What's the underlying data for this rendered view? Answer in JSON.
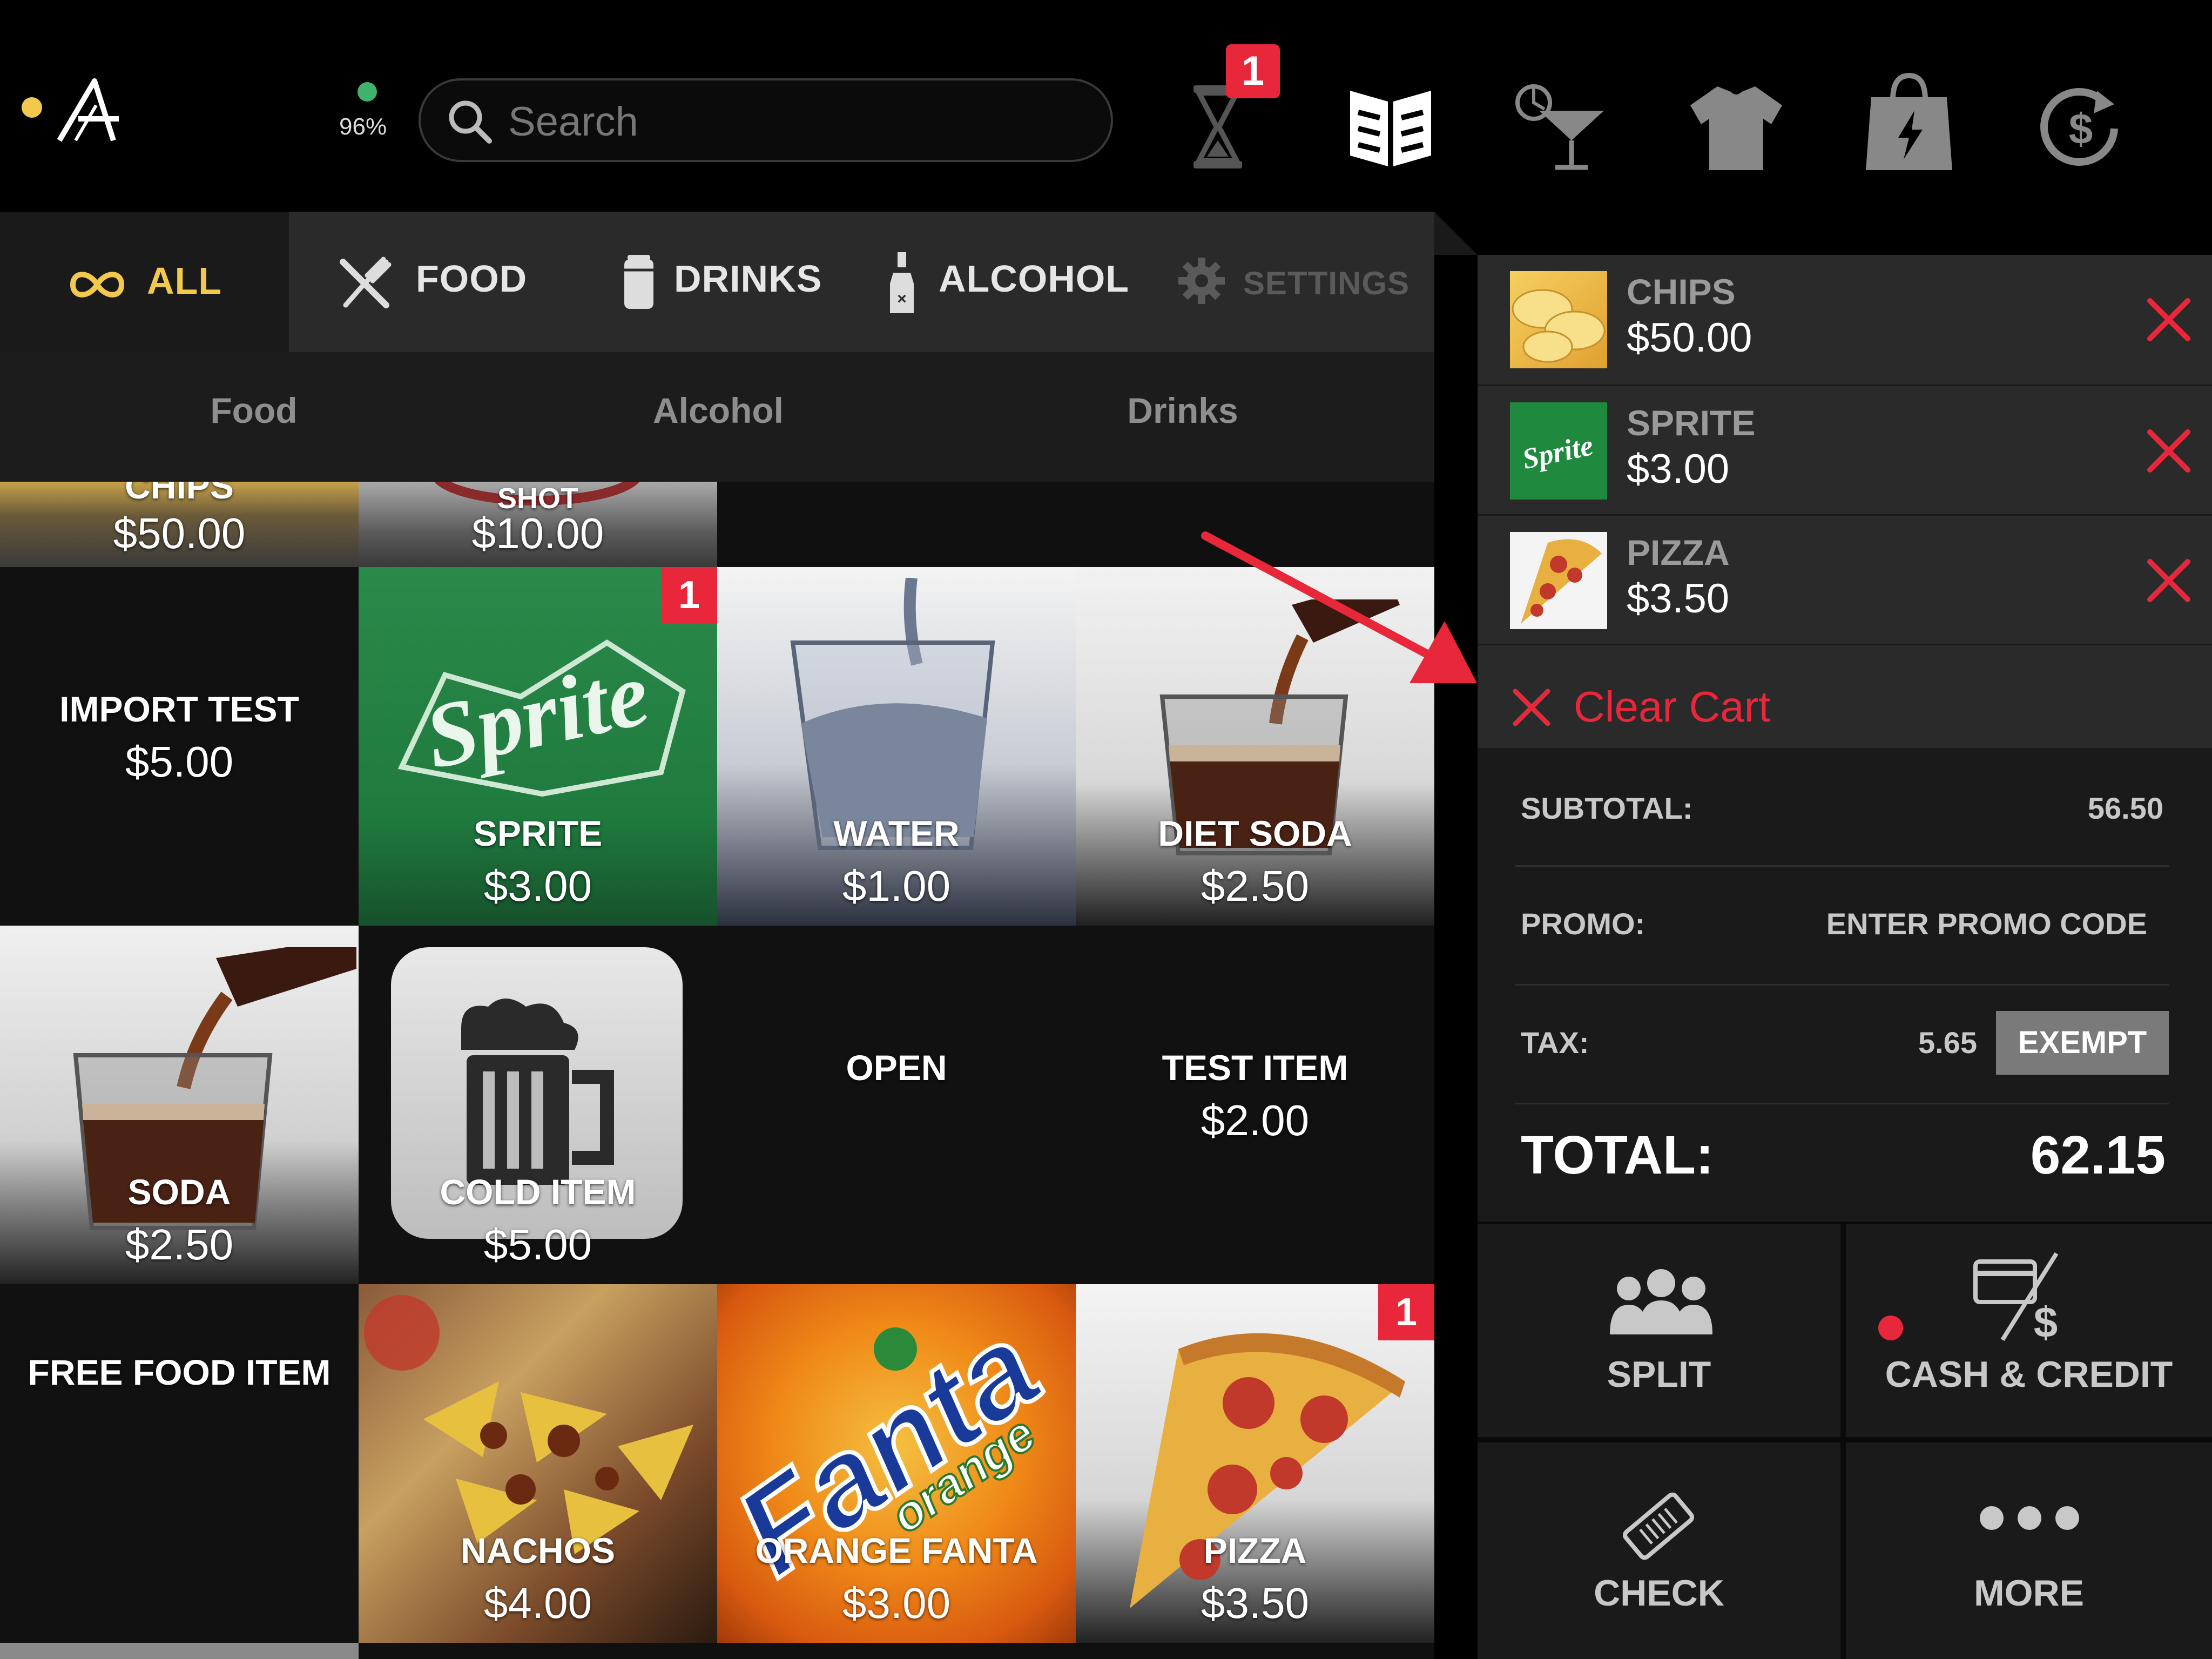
{
  "topbar": {
    "battery": "96%",
    "search_placeholder": "Search",
    "timer_badge": "1"
  },
  "categories": [
    {
      "label": "ALL",
      "icon": "infinity-icon",
      "active": true
    },
    {
      "label": "FOOD",
      "icon": "fork-knife-icon"
    },
    {
      "label": "DRINKS",
      "icon": "can-icon"
    },
    {
      "label": "ALCOHOL",
      "icon": "bottle-icon"
    },
    {
      "label": "SETTINGS",
      "icon": "gear-icon"
    }
  ],
  "subcategories": [
    "Food",
    "Alcohol",
    "Drinks"
  ],
  "tiles": {
    "chips": {
      "name": "CHIPS",
      "price": "$50.00"
    },
    "shot": {
      "name": "SHOT",
      "price": "$10.00"
    },
    "import_test": {
      "name": "IMPORT TEST",
      "price": "$5.00"
    },
    "sprite": {
      "name": "SPRITE",
      "price": "$3.00",
      "badge": "1",
      "logo": "Sprite"
    },
    "water": {
      "name": "WATER",
      "price": "$1.00"
    },
    "diet_soda": {
      "name": "DIET SODA",
      "price": "$2.50"
    },
    "soda": {
      "name": "SODA",
      "price": "$2.50"
    },
    "cold_item": {
      "name": "COLD ITEM",
      "price": "$5.00"
    },
    "open": {
      "name": "OPEN"
    },
    "test_item": {
      "name": "TEST ITEM",
      "price": "$2.00"
    },
    "free_food": {
      "name": "FREE FOOD ITEM"
    },
    "nachos": {
      "name": "NACHOS",
      "price": "$4.00"
    },
    "orange_fanta": {
      "name": "ORANGE FANTA",
      "price": "$3.00",
      "logo": "Fanta",
      "logo_sub": "orange"
    },
    "pizza": {
      "name": "PIZZA",
      "price": "$3.50",
      "badge": "1"
    }
  },
  "cart": {
    "items": [
      {
        "name": "CHIPS",
        "price": "$50.00"
      },
      {
        "name": "SPRITE",
        "price": "$3.00",
        "logo": "Sprite"
      },
      {
        "name": "PIZZA",
        "price": "$3.50"
      }
    ],
    "clear_label": "Clear Cart"
  },
  "summary": {
    "subtotal_label": "SUBTOTAL:",
    "subtotal_value": "56.50",
    "promo_label": "PROMO:",
    "promo_placeholder": "ENTER PROMO CODE",
    "tax_label": "TAX:",
    "tax_value": "5.65",
    "exempt_label": "EXEMPT",
    "total_label": "TOTAL:",
    "total_value": "62.15"
  },
  "actions": {
    "split": "SPLIT",
    "cash_credit": "CASH & CREDIT",
    "check": "CHECK",
    "more": "MORE"
  },
  "colors": {
    "accent_red": "#e8283a",
    "accent_yellow": "#f2c94c",
    "status_green": "#3fb26b"
  }
}
